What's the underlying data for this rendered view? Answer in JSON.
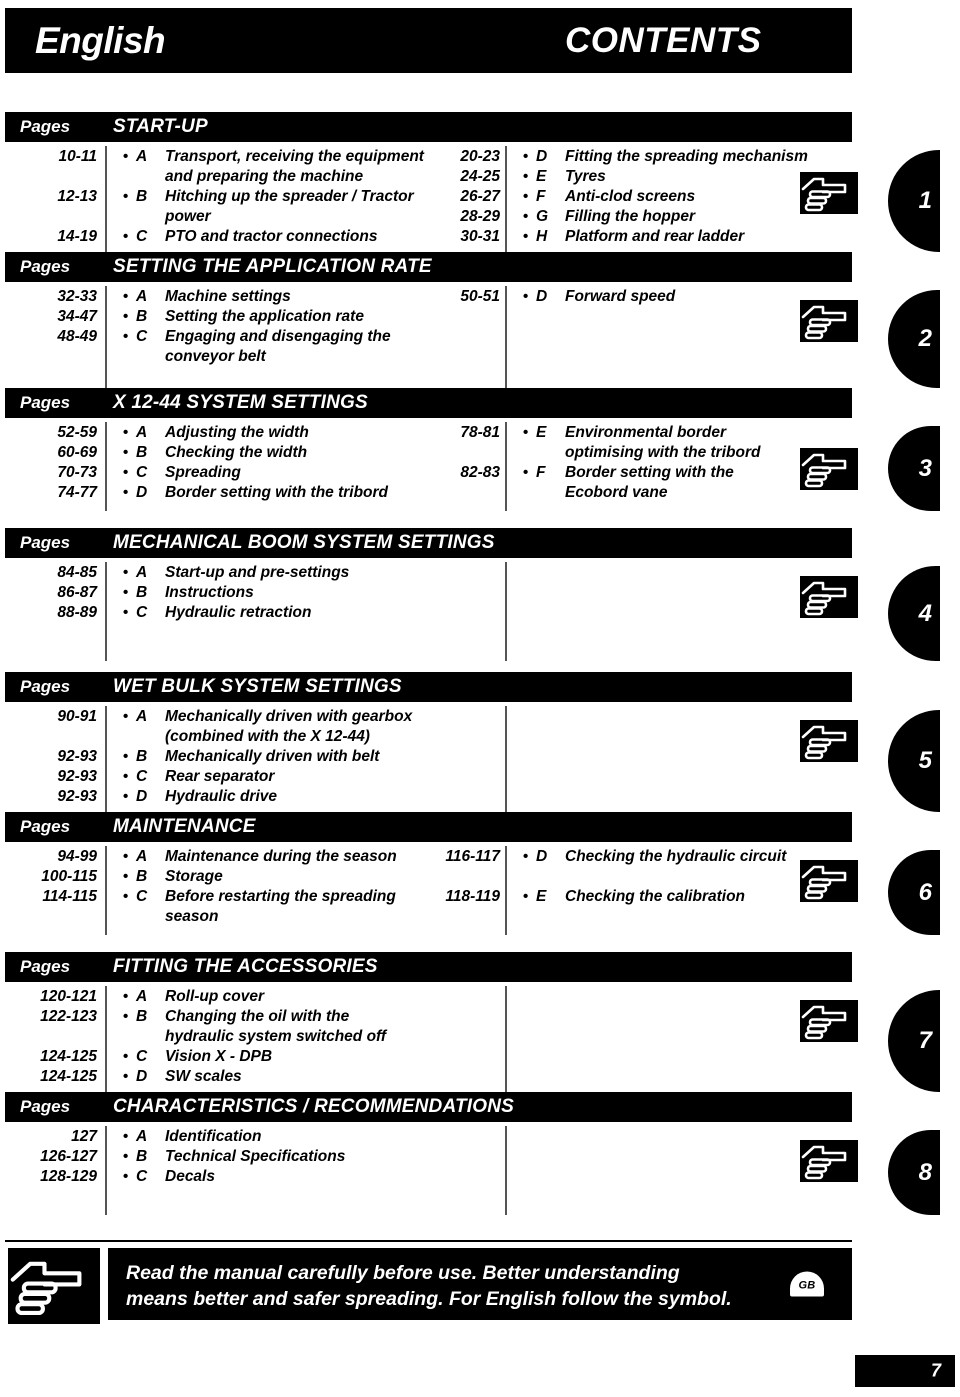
{
  "header": {
    "language": "English",
    "title": "CONTENTS"
  },
  "pages_label": "Pages",
  "bullet_glyph": "•",
  "icons": {
    "hand": "pointing-hand-icon",
    "gb_badge": "GB"
  },
  "sections": [
    {
      "title": "START-UP",
      "tab": "1",
      "left": [
        {
          "pages": "10-11",
          "letter": "A",
          "text": "Transport, receiving the equipment"
        },
        {
          "pages": "",
          "letter": "",
          "text": "and preparing the machine"
        },
        {
          "pages": "12-13",
          "letter": "B",
          "text": "Hitching up the spreader / Tractor"
        },
        {
          "pages": "",
          "letter": "",
          "text": "power"
        },
        {
          "pages": "14-19",
          "letter": "C",
          "text": "PTO and tractor connections"
        }
      ],
      "right": [
        {
          "pages": "20-23",
          "letter": "D",
          "text": "Fitting the spreading mechanism"
        },
        {
          "pages": "24-25",
          "letter": "E",
          "text": "Tyres"
        },
        {
          "pages": "26-27",
          "letter": "F",
          "text": "Anti-clod screens"
        },
        {
          "pages": "28-29",
          "letter": "G",
          "text": "Filling the hopper"
        },
        {
          "pages": "30-31",
          "letter": "H",
          "text": "Platform and rear ladder"
        }
      ]
    },
    {
      "title": "SETTING THE APPLICATION RATE",
      "tab": "2",
      "left": [
        {
          "pages": "32-33",
          "letter": "A",
          "text": "Machine settings"
        },
        {
          "pages": "34-47",
          "letter": "B",
          "text": "Setting the application rate"
        },
        {
          "pages": "48-49",
          "letter": "C",
          "text": "Engaging and disengaging the"
        },
        {
          "pages": "",
          "letter": "",
          "text": "conveyor belt"
        }
      ],
      "right": [
        {
          "pages": "50-51",
          "letter": "D",
          "text": "Forward speed"
        }
      ]
    },
    {
      "title": "X 12-44 SYSTEM SETTINGS",
      "tab": "3",
      "left": [
        {
          "pages": "52-59",
          "letter": "A",
          "text": "Adjusting the width"
        },
        {
          "pages": "60-69",
          "letter": "B",
          "text": "Checking the width"
        },
        {
          "pages": "70-73",
          "letter": "C",
          "text": "Spreading"
        },
        {
          "pages": "74-77",
          "letter": "D",
          "text": "Border setting with the tribord"
        }
      ],
      "right": [
        {
          "pages": "78-81",
          "letter": "E",
          "text": "Environmental border"
        },
        {
          "pages": "",
          "letter": "",
          "text": "optimising with the tribord"
        },
        {
          "pages": "82-83",
          "letter": "F",
          "text": "Border setting with the"
        },
        {
          "pages": "",
          "letter": "",
          "text": "Ecobord vane"
        }
      ]
    },
    {
      "title": "MECHANICAL BOOM SYSTEM SETTINGS",
      "tab": "4",
      "left": [
        {
          "pages": "84-85",
          "letter": "A",
          "text": "Start-up and pre-settings"
        },
        {
          "pages": "86-87",
          "letter": "B",
          "text": "Instructions"
        },
        {
          "pages": "88-89",
          "letter": "C",
          "text": "Hydraulic retraction"
        }
      ],
      "right": []
    },
    {
      "title": "WET BULK SYSTEM SETTINGS",
      "tab": "5",
      "left": [
        {
          "pages": "90-91",
          "letter": "A",
          "text": "Mechanically driven with gearbox"
        },
        {
          "pages": "",
          "letter": "",
          "text": "(combined with the X 12-44)"
        },
        {
          "pages": "92-93",
          "letter": "B",
          "text": "Mechanically driven with belt"
        },
        {
          "pages": "92-93",
          "letter": "C",
          "text": "Rear separator"
        },
        {
          "pages": "92-93",
          "letter": "D",
          "text": "Hydraulic drive"
        }
      ],
      "right": []
    },
    {
      "title": "MAINTENANCE",
      "tab": "6",
      "left": [
        {
          "pages": "94-99",
          "letter": "A",
          "text": "Maintenance during the season"
        },
        {
          "pages": "100-115",
          "letter": "B",
          "text": "Storage"
        },
        {
          "pages": "114-115",
          "letter": "C",
          "text": "Before restarting the spreading"
        },
        {
          "pages": "",
          "letter": "",
          "text": "season"
        }
      ],
      "right": [
        {
          "pages": "116-117",
          "letter": "D",
          "text": "Checking the hydraulic circuit"
        },
        {
          "pages": "",
          "letter": "",
          "text": ""
        },
        {
          "pages": "118-119",
          "letter": "E",
          "text": "Checking the calibration"
        }
      ]
    },
    {
      "title": "FITTING THE ACCESSORIES",
      "tab": "7",
      "left": [
        {
          "pages": "120-121",
          "letter": "A",
          "text": "Roll-up cover"
        },
        {
          "pages": "122-123",
          "letter": "B",
          "text": "Changing the oil with the"
        },
        {
          "pages": "",
          "letter": "",
          "text": "hydraulic system switched off"
        },
        {
          "pages": "124-125",
          "letter": "C",
          "text": "Vision X - DPB"
        },
        {
          "pages": "124-125",
          "letter": "D",
          "text": "SW scales"
        }
      ],
      "right": []
    },
    {
      "title": "CHARACTERISTICS / RECOMMENDATIONS",
      "tab": "8",
      "left": [
        {
          "pages": "127",
          "letter": "A",
          "text": "Identification"
        },
        {
          "pages": "126-127",
          "letter": "B",
          "text": "Technical Specifications"
        },
        {
          "pages": "128-129",
          "letter": "C",
          "text": "Decals"
        }
      ],
      "right": []
    }
  ],
  "footer": {
    "line1": "Read the manual carefully before use. Better understanding",
    "line2": "means better and safer spreading. For English follow the symbol.",
    "badge": "GB"
  },
  "page_number": "7"
}
